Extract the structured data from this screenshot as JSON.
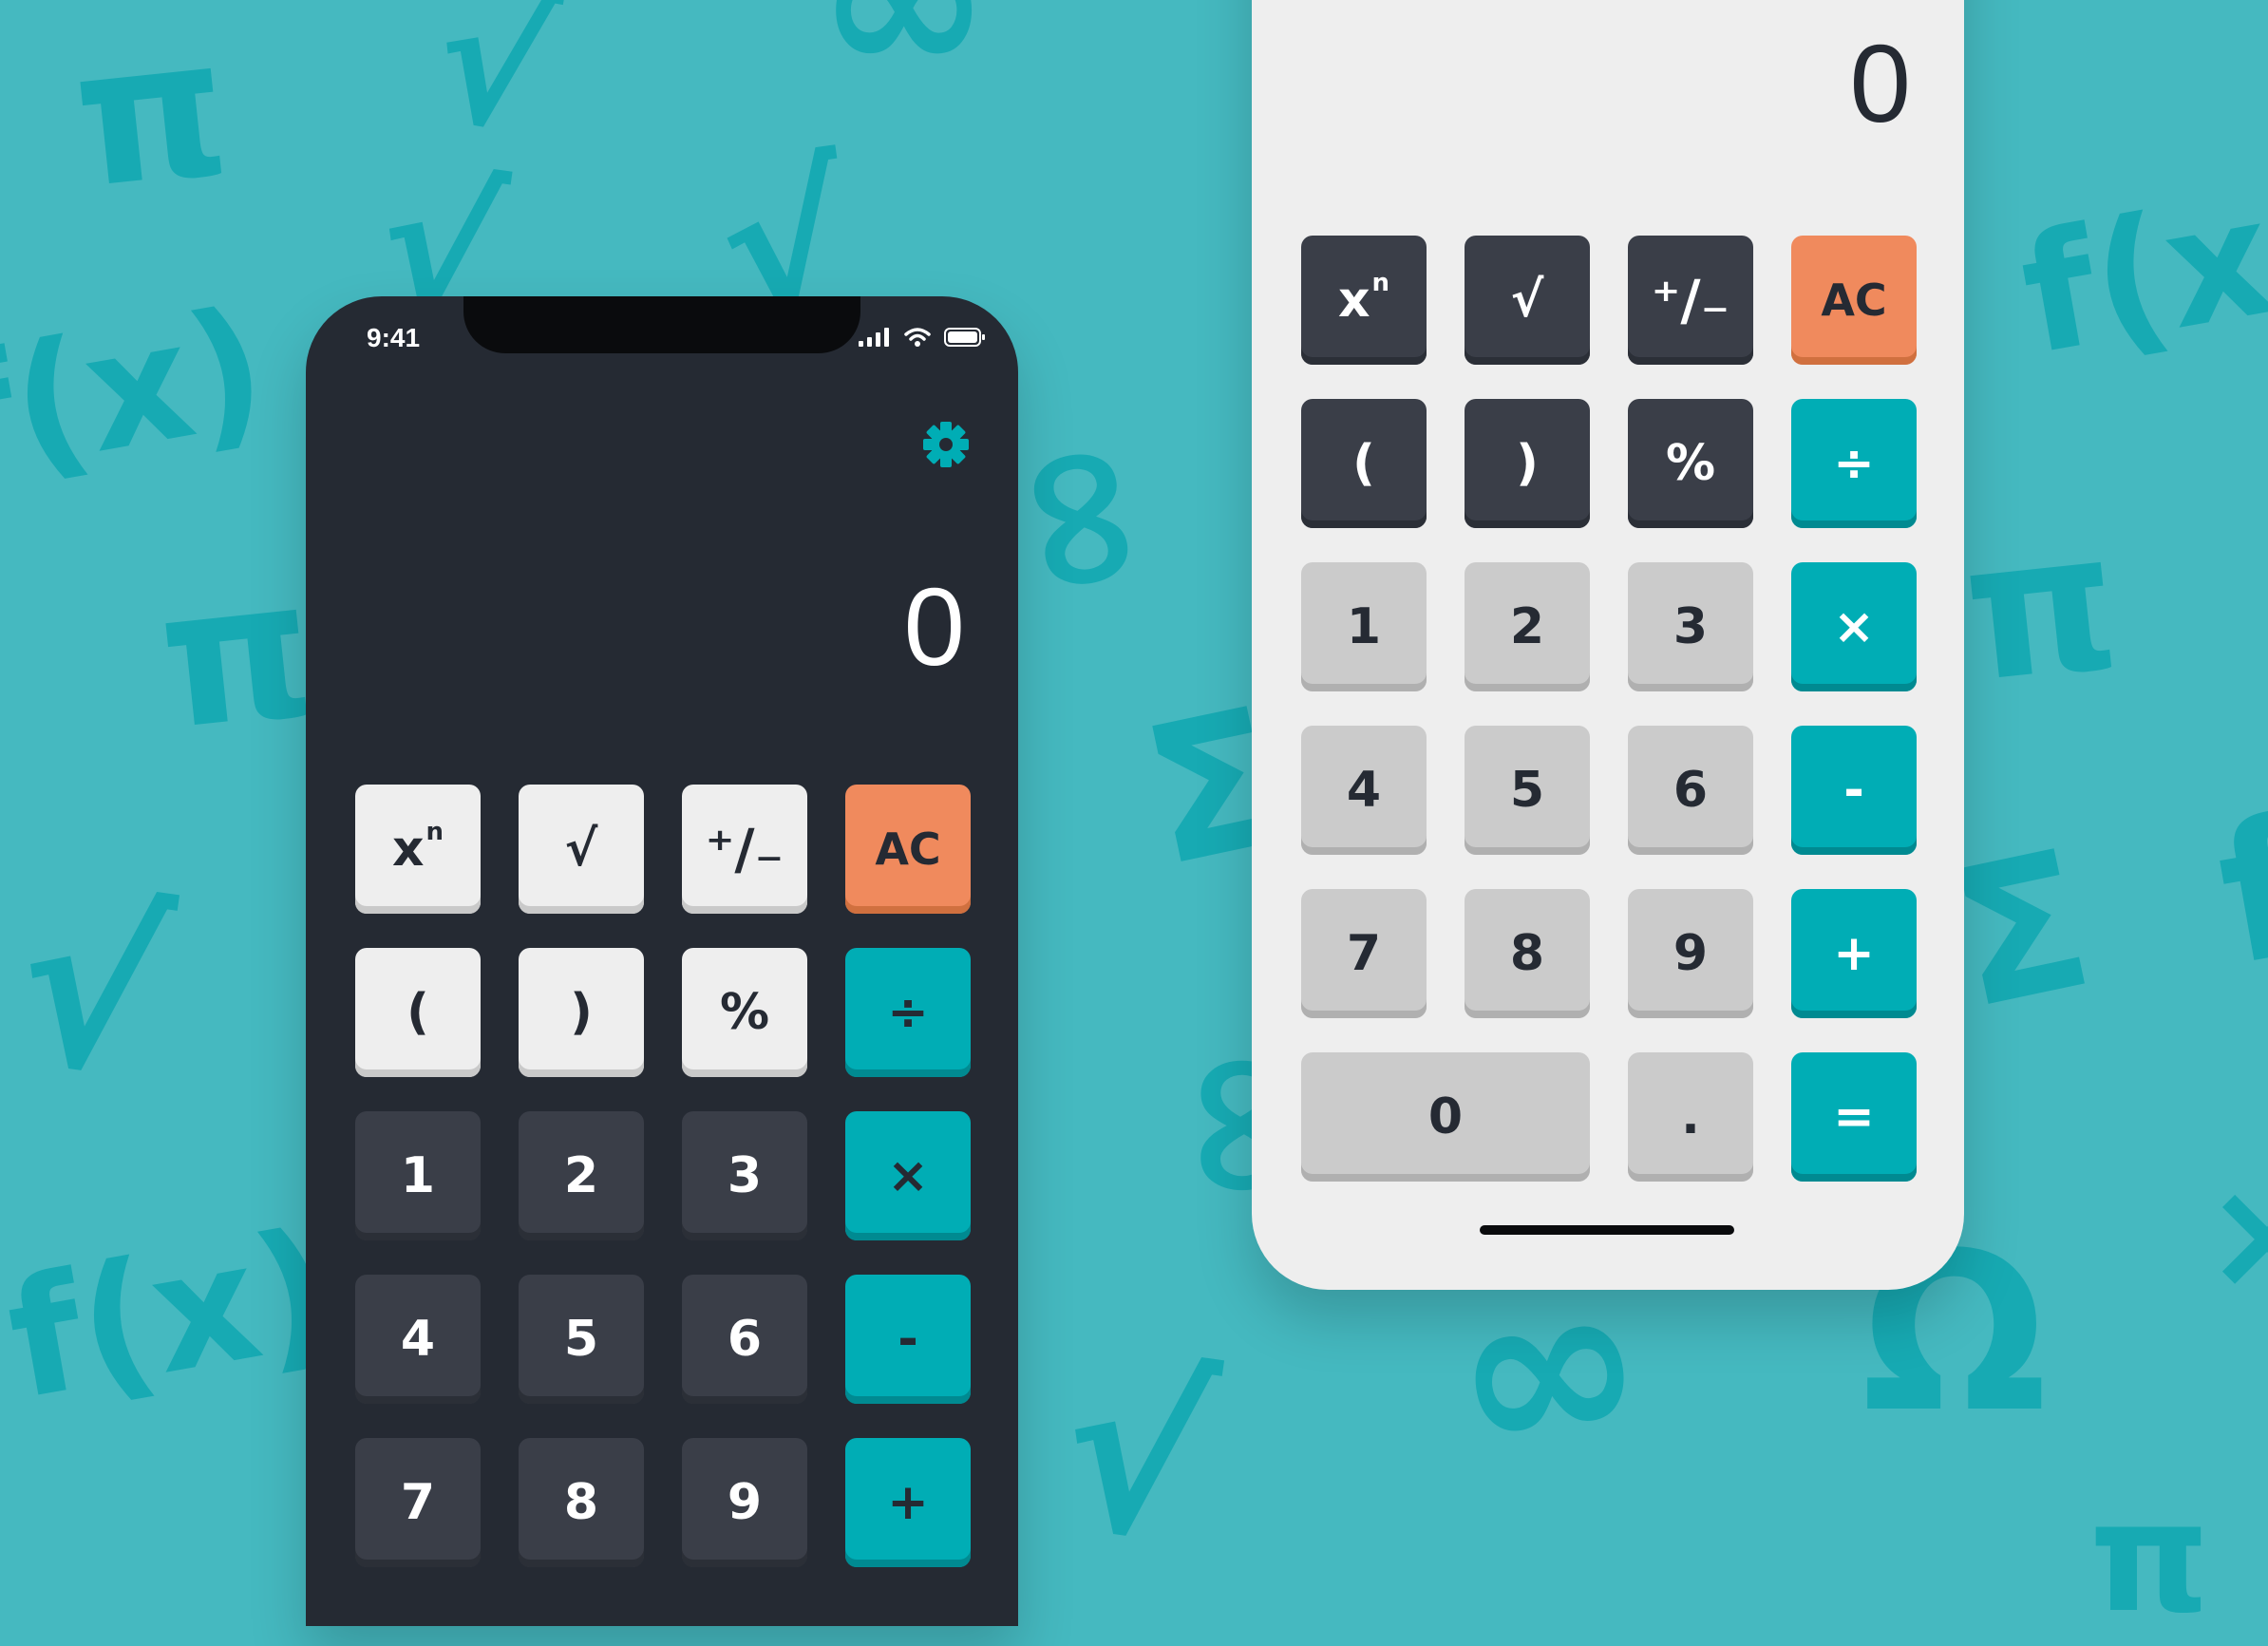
{
  "colors": {
    "background": "#45b9c0",
    "symbols": "#17aab3",
    "dark_phone": "#252a33",
    "light_phone": "#eeeeee",
    "accent_teal": "#00adb5",
    "accent_orange": "#f08a5d"
  },
  "background_symbols": [
    "π",
    "√",
    "∞",
    "√",
    "f(x)",
    "π",
    "√",
    "f(x)",
    "∞",
    "Σ",
    "∞",
    "∞",
    "f(x)",
    "π",
    "Σ",
    "Ω",
    "f",
    "√",
    "√",
    "π",
    "⨯"
  ],
  "dark_calculator": {
    "status": {
      "time": "9:41"
    },
    "settings_icon": "gear-icon",
    "display": "0",
    "keys": [
      {
        "label": "x",
        "sup": "n",
        "style": "k-light",
        "name": "power-key"
      },
      {
        "label": "√",
        "style": "k-light",
        "name": "sqrt-key"
      },
      {
        "label": "⁺∕₋",
        "style": "k-light",
        "name": "plus-minus-key"
      },
      {
        "label": "AC",
        "style": "k-orange",
        "name": "clear-key"
      },
      {
        "label": "(",
        "style": "k-light",
        "name": "open-paren-key"
      },
      {
        "label": ")",
        "style": "k-light",
        "name": "close-paren-key"
      },
      {
        "label": "%",
        "style": "k-light",
        "name": "percent-key"
      },
      {
        "label": "÷",
        "style": "k-teal",
        "name": "divide-key"
      },
      {
        "label": "1",
        "style": "k-darkslate",
        "name": "digit-1-key"
      },
      {
        "label": "2",
        "style": "k-darkslate",
        "name": "digit-2-key"
      },
      {
        "label": "3",
        "style": "k-darkslate",
        "name": "digit-3-key"
      },
      {
        "label": "×",
        "style": "k-teal",
        "name": "multiply-key"
      },
      {
        "label": "4",
        "style": "k-darkslate",
        "name": "digit-4-key"
      },
      {
        "label": "5",
        "style": "k-darkslate",
        "name": "digit-5-key"
      },
      {
        "label": "6",
        "style": "k-darkslate",
        "name": "digit-6-key"
      },
      {
        "label": "-",
        "style": "k-teal",
        "name": "subtract-key"
      },
      {
        "label": "7",
        "style": "k-darkslate",
        "name": "digit-7-key"
      },
      {
        "label": "8",
        "style": "k-darkslate",
        "name": "digit-8-key"
      },
      {
        "label": "9",
        "style": "k-darkslate",
        "name": "digit-9-key"
      },
      {
        "label": "+",
        "style": "k-teal",
        "name": "add-key"
      }
    ]
  },
  "light_calculator": {
    "display": "0",
    "keys": [
      {
        "label": "x",
        "sup": "n",
        "style": "k-darkslate",
        "name": "power-key"
      },
      {
        "label": "√",
        "style": "k-darkslate",
        "name": "sqrt-key"
      },
      {
        "label": "⁺∕₋",
        "style": "k-darkslate",
        "name": "plus-minus-key"
      },
      {
        "label": "AC",
        "style": "k-orange",
        "name": "clear-key"
      },
      {
        "label": "(",
        "style": "k-darkslate",
        "name": "open-paren-key"
      },
      {
        "label": ")",
        "style": "k-darkslate",
        "name": "close-paren-key"
      },
      {
        "label": "%",
        "style": "k-darkslate",
        "name": "percent-key"
      },
      {
        "label": "÷",
        "style": "k-lteal",
        "name": "divide-key"
      },
      {
        "label": "1",
        "style": "k-grey",
        "name": "digit-1-key"
      },
      {
        "label": "2",
        "style": "k-grey",
        "name": "digit-2-key"
      },
      {
        "label": "3",
        "style": "k-grey",
        "name": "digit-3-key"
      },
      {
        "label": "×",
        "style": "k-lteal",
        "name": "multiply-key"
      },
      {
        "label": "4",
        "style": "k-grey",
        "name": "digit-4-key"
      },
      {
        "label": "5",
        "style": "k-grey",
        "name": "digit-5-key"
      },
      {
        "label": "6",
        "style": "k-grey",
        "name": "digit-6-key"
      },
      {
        "label": "-",
        "style": "k-lteal",
        "name": "subtract-key"
      },
      {
        "label": "7",
        "style": "k-grey",
        "name": "digit-7-key"
      },
      {
        "label": "8",
        "style": "k-grey",
        "name": "digit-8-key"
      },
      {
        "label": "9",
        "style": "k-grey",
        "name": "digit-9-key"
      },
      {
        "label": "+",
        "style": "k-lteal",
        "name": "add-key"
      },
      {
        "label": "0",
        "style": "k-grey",
        "name": "digit-0-key",
        "wide": true
      },
      {
        "label": ".",
        "style": "k-grey",
        "name": "decimal-key"
      },
      {
        "label": "=",
        "style": "k-lteal",
        "name": "equals-key"
      }
    ]
  }
}
